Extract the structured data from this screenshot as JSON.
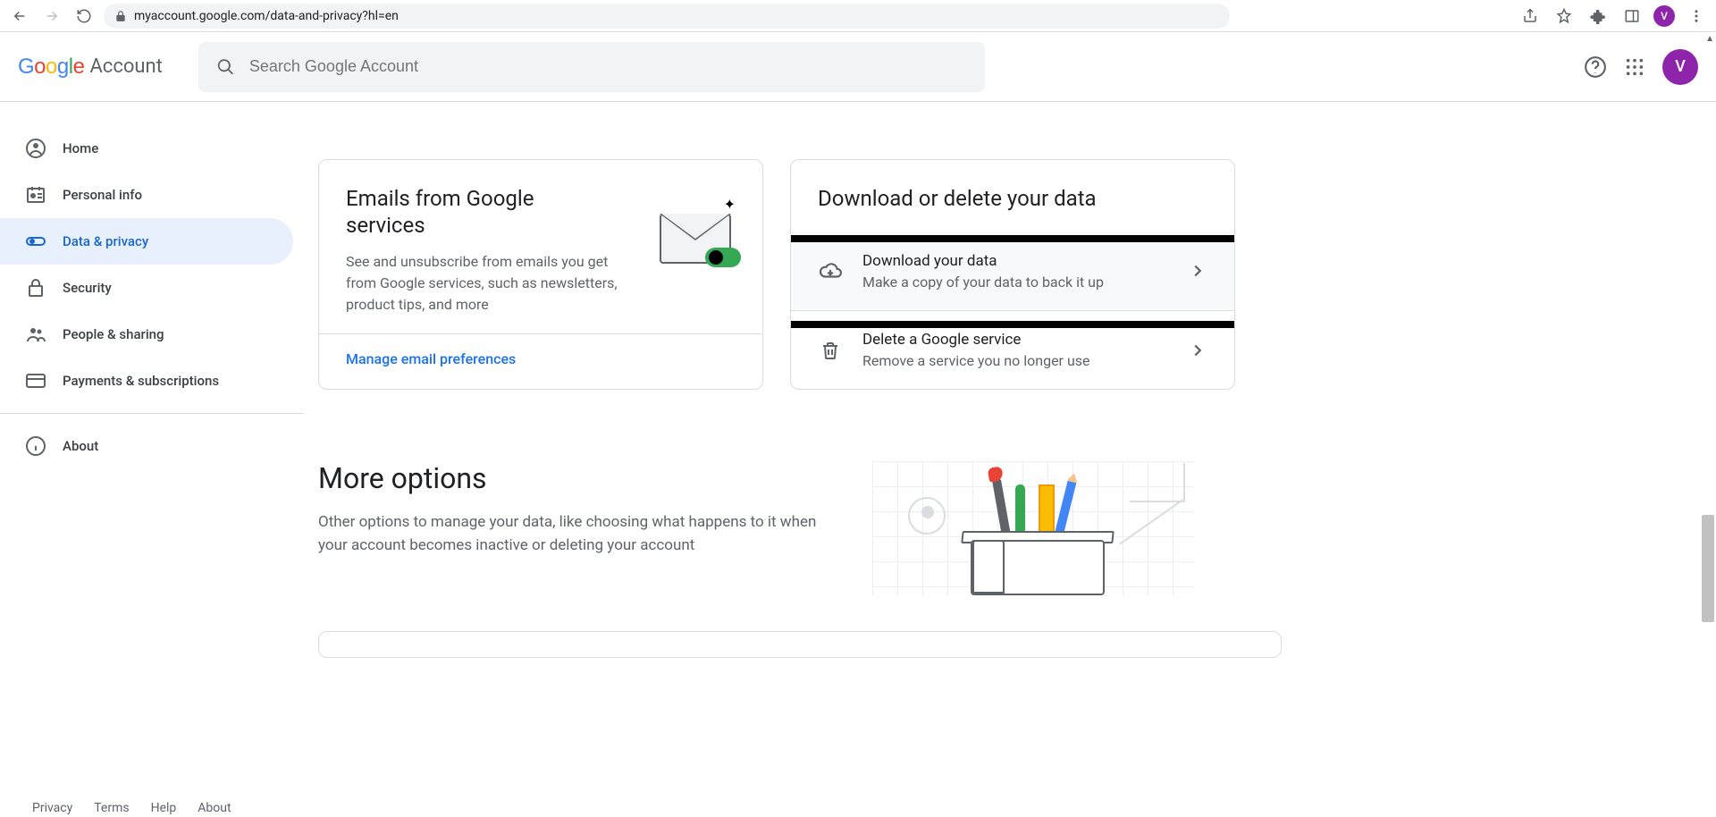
{
  "browser": {
    "url": "myaccount.google.com/data-and-privacy?hl=en",
    "avatar_letter": "V"
  },
  "header": {
    "logo_account_text": "Account",
    "search_placeholder": "Search Google Account",
    "avatar_letter": "V"
  },
  "sidebar": {
    "items": [
      {
        "label": "Home"
      },
      {
        "label": "Personal info"
      },
      {
        "label": "Data & privacy"
      },
      {
        "label": "Security"
      },
      {
        "label": "People & sharing"
      },
      {
        "label": "Payments & subscriptions"
      },
      {
        "label": "About"
      }
    ]
  },
  "emails_card": {
    "title": "Emails from Google services",
    "subtitle": "See and unsubscribe from emails you get from Google services, such as newsletters, product tips, and more",
    "link": "Manage email preferences"
  },
  "download_card": {
    "title": "Download or delete your data",
    "items": [
      {
        "title": "Download your data",
        "subtitle": "Make a copy of your data to back it up"
      },
      {
        "title": "Delete a Google service",
        "subtitle": "Remove a service you no longer use"
      }
    ]
  },
  "more_section": {
    "title": "More options",
    "subtitle": "Other options to manage your data, like choosing what happens to it when your account becomes inactive or deleting your account"
  },
  "footer": {
    "links": [
      "Privacy",
      "Terms",
      "Help",
      "About"
    ]
  }
}
